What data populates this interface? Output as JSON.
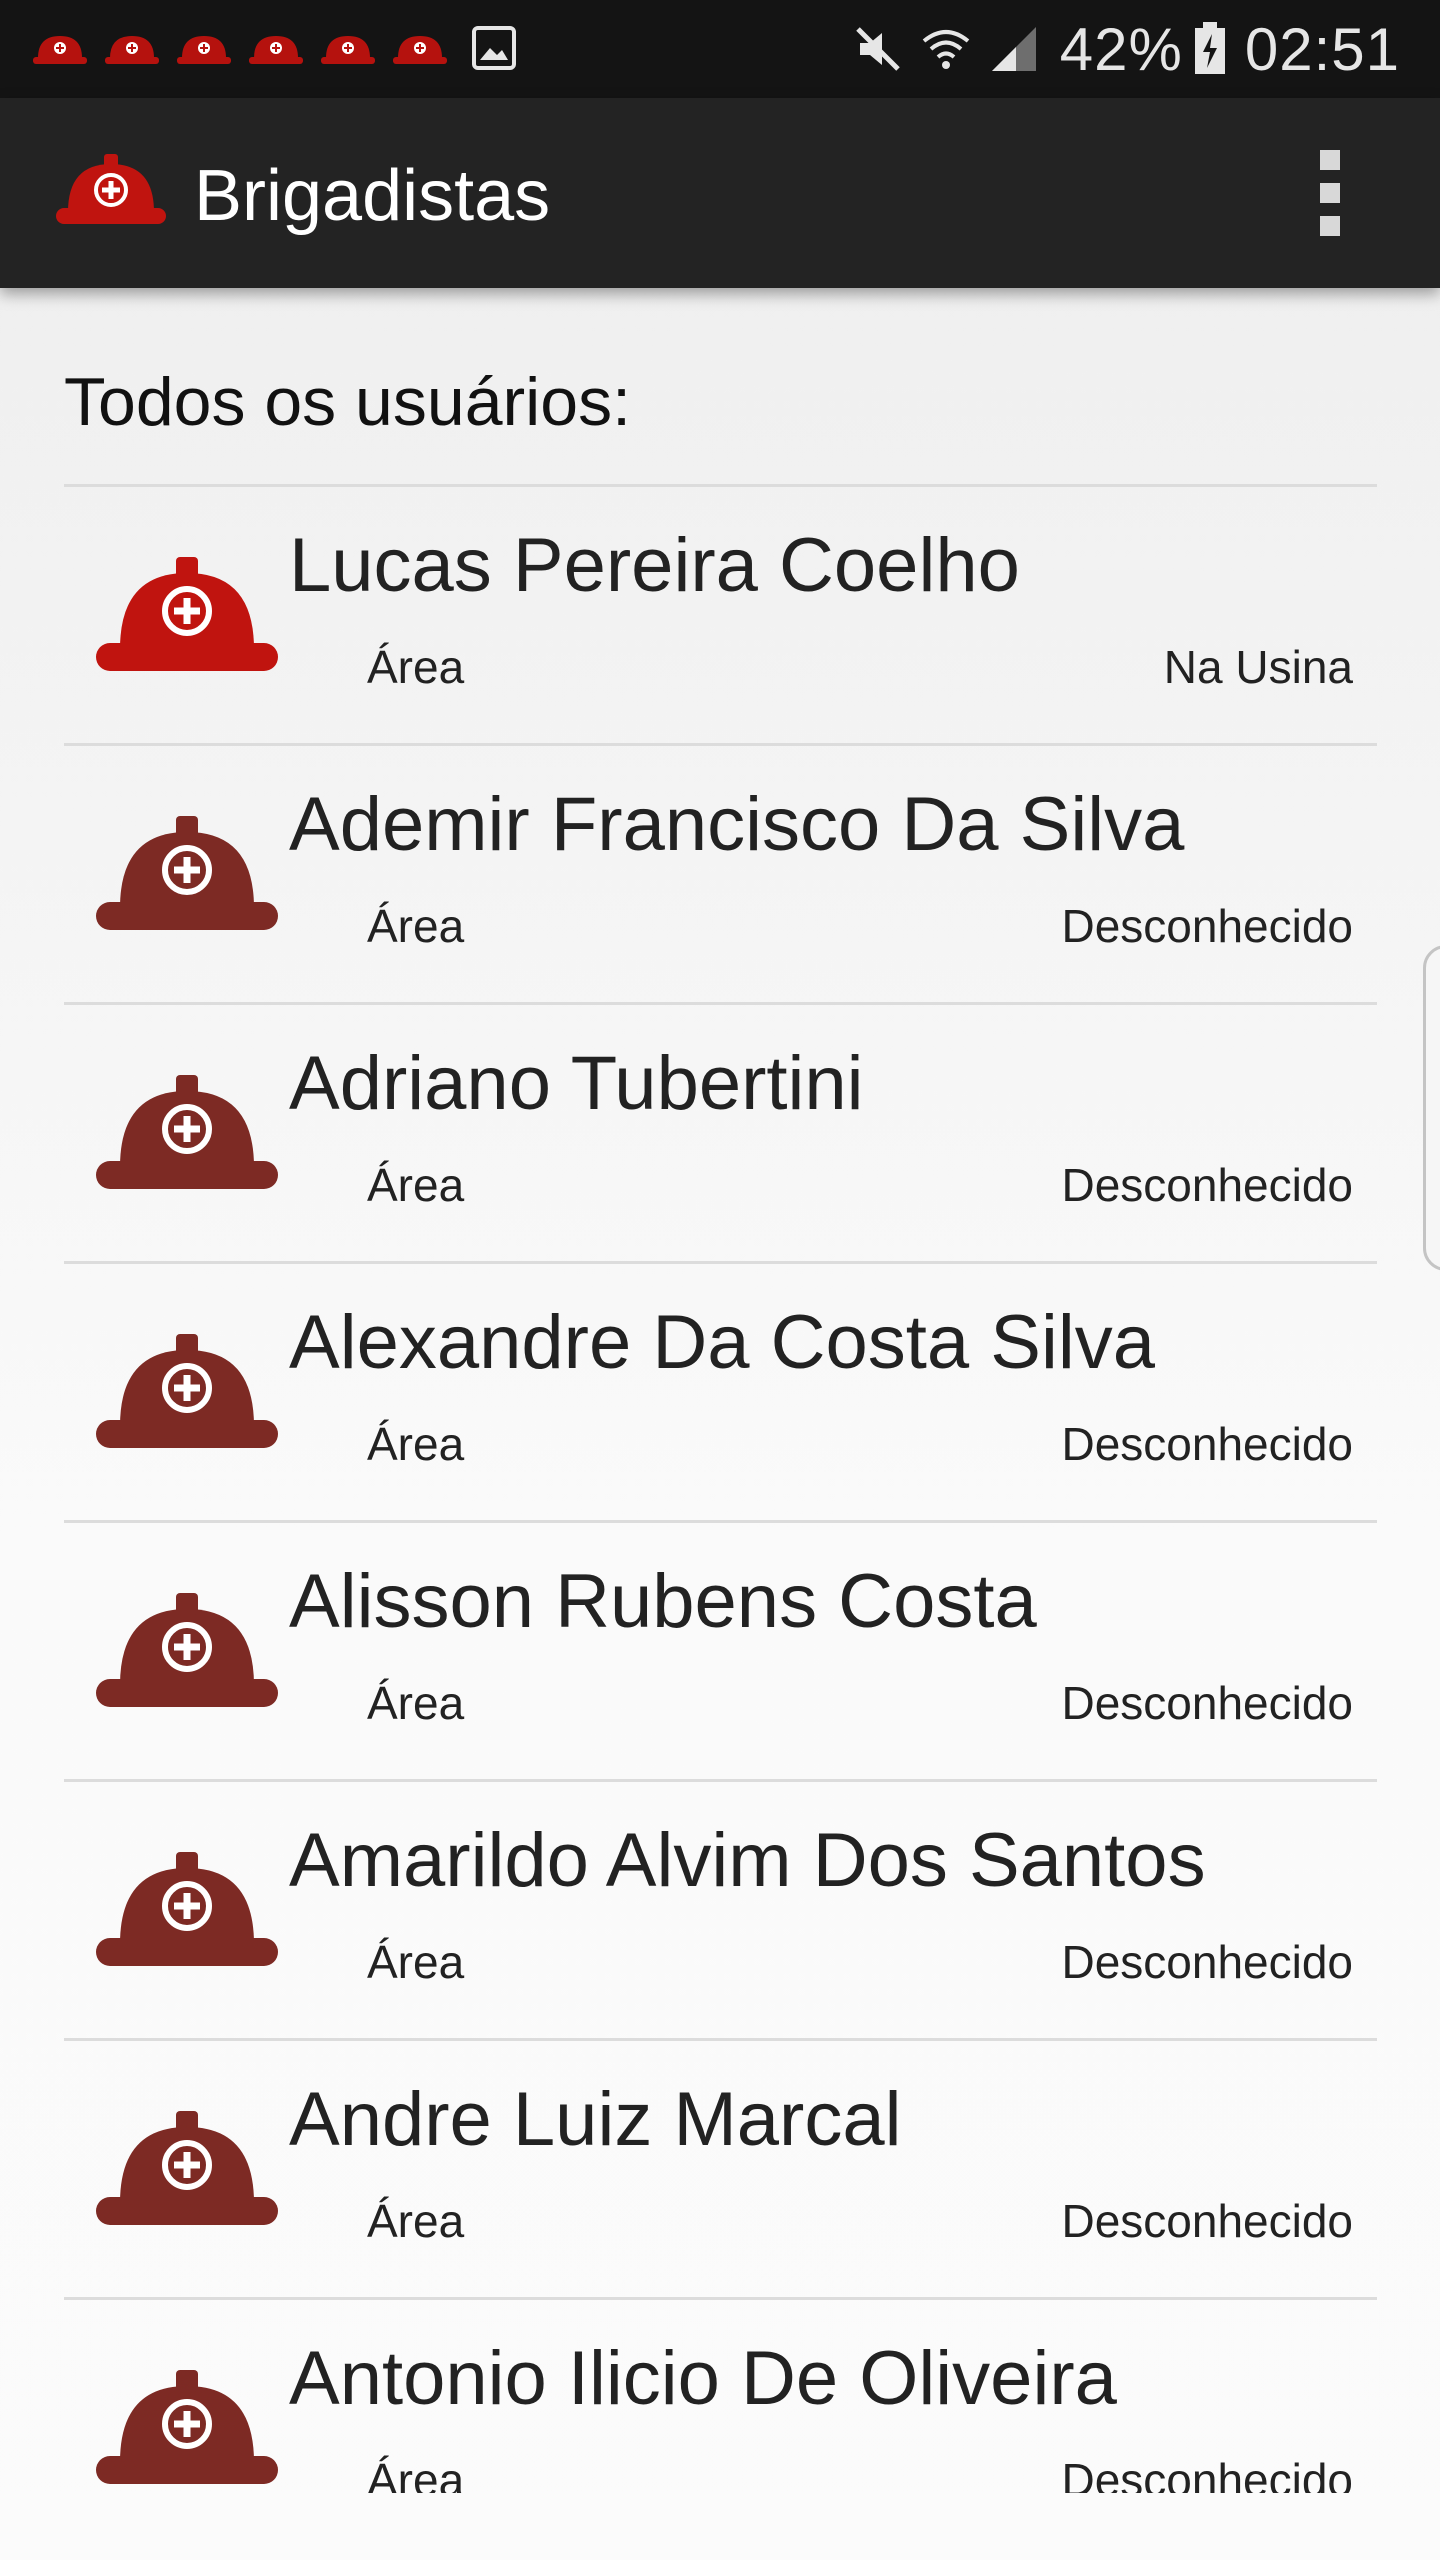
{
  "status_bar": {
    "notification_icons": [
      "helmet-icon",
      "helmet-icon",
      "helmet-icon",
      "helmet-icon",
      "helmet-icon",
      "helmet-icon",
      "image-icon"
    ],
    "battery_percent": "42%",
    "time": "02:51",
    "indicator_icons": [
      "mute-icon",
      "wifi-icon",
      "signal-icon",
      "battery-charging-icon"
    ]
  },
  "toolbar": {
    "title": "Brigadistas",
    "app_icon": "helmet-icon",
    "menu_icon": "overflow-menu-icon"
  },
  "main": {
    "section_title": "Todos os usuários:",
    "users": [
      {
        "name": "Lucas Pereira Coelho",
        "area_label": "Área",
        "status": "Na Usina",
        "active": true
      },
      {
        "name": "Ademir Francisco Da Silva",
        "area_label": "Área",
        "status": "Desconhecido",
        "active": false
      },
      {
        "name": "Adriano Tubertini",
        "area_label": "Área",
        "status": "Desconhecido",
        "active": false
      },
      {
        "name": "Alexandre Da Costa Silva",
        "area_label": "Área",
        "status": "Desconhecido",
        "active": false
      },
      {
        "name": "Alisson Rubens Costa",
        "area_label": "Área",
        "status": "Desconhecido",
        "active": false
      },
      {
        "name": "Amarildo Alvim Dos Santos",
        "area_label": "Área",
        "status": "Desconhecido",
        "active": false
      },
      {
        "name": "Andre Luiz Marcal",
        "area_label": "Área",
        "status": "Desconhecido",
        "active": false
      },
      {
        "name": "Antonio Ilicio De Oliveira",
        "area_label": "Área",
        "status": "Desconhecido",
        "active": false
      }
    ]
  },
  "colors": {
    "helmet_active": "#c0140f",
    "helmet_inactive": "#7d2a24",
    "toolbar_bg": "#232323",
    "status_bar_bg": "#141414"
  }
}
